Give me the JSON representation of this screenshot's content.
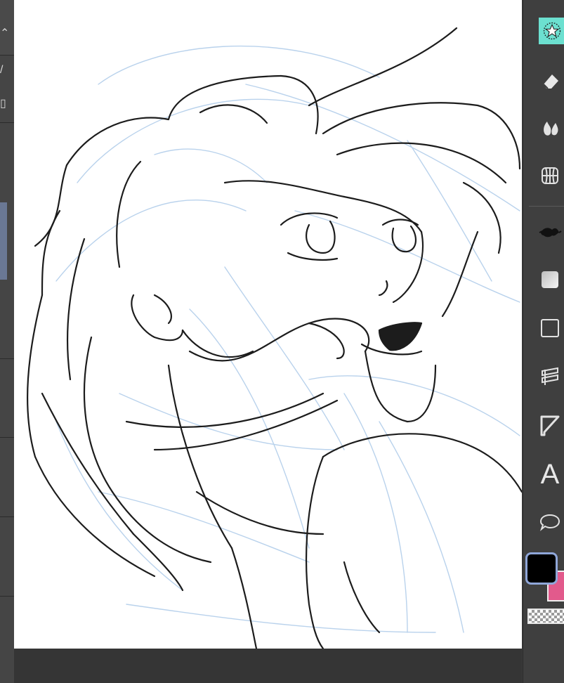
{
  "left_panel": {
    "icons": [
      "chevron-updown-icon",
      "pen-icon",
      "panel-icon"
    ]
  },
  "canvas": {
    "artwork": "line-art-girl-windswept-hair",
    "bg": "#ffffff"
  },
  "tool_strip": {
    "tools": [
      {
        "name": "favorite-tool-icon",
        "active": true
      },
      {
        "name": "eraser-tool-icon"
      },
      {
        "name": "blend-tool-icon"
      },
      {
        "name": "perspective-ruler-icon"
      },
      {
        "name": "fill-bucket-icon"
      },
      {
        "name": "gradient-tool-icon"
      },
      {
        "name": "figure-tool-icon"
      },
      {
        "name": "frame-border-icon"
      },
      {
        "name": "ruler-tool-icon"
      },
      {
        "name": "text-tool-icon"
      },
      {
        "name": "balloon-tool-icon"
      }
    ],
    "text_tool_glyph": "A",
    "colors": {
      "main": "#000000",
      "sub": "#e25a8c",
      "active_highlight": "#6ce0d0"
    }
  }
}
